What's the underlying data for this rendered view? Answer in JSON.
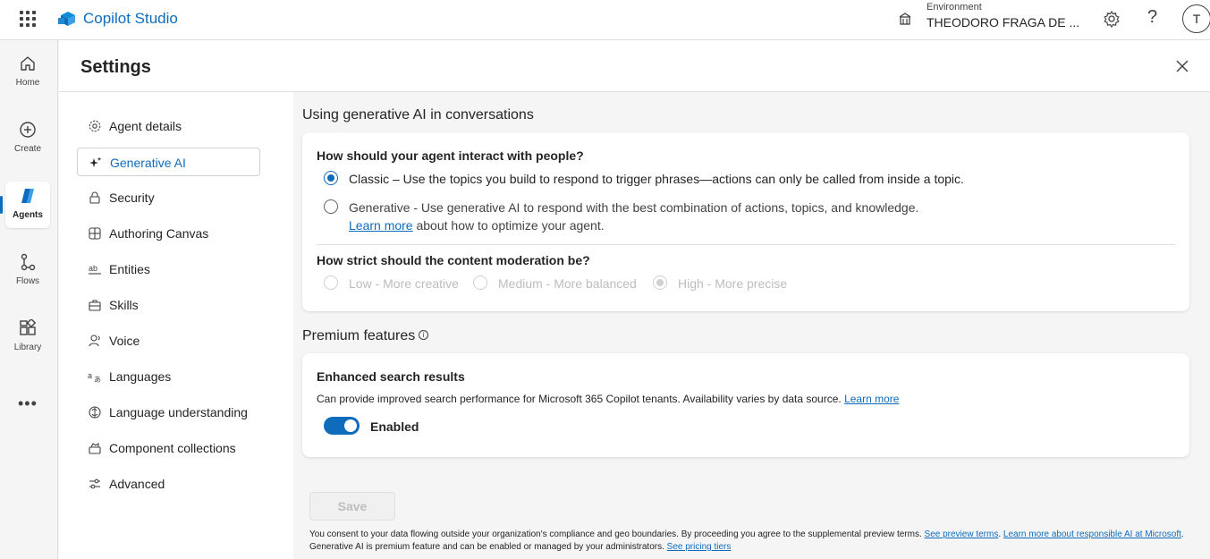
{
  "topbar": {
    "app_title": "Copilot Studio",
    "environment_label": "Environment",
    "environment_value": "THEODORO FRAGA DE ...",
    "avatar_initial": "T"
  },
  "rail": {
    "items": [
      {
        "label": "Home",
        "icon": "home-icon"
      },
      {
        "label": "Create",
        "icon": "plus-circle-icon"
      },
      {
        "label": "Agents",
        "icon": "agents-icon",
        "active": true
      },
      {
        "label": "Flows",
        "icon": "flows-icon"
      },
      {
        "label": "Library",
        "icon": "library-icon"
      }
    ],
    "more_label": "•••"
  },
  "settings": {
    "title": "Settings",
    "nav": [
      {
        "label": "Agent details",
        "icon": "gear-icon"
      },
      {
        "label": "Generative AI",
        "icon": "sparkle-icon",
        "active": true
      },
      {
        "label": "Security",
        "icon": "lock-icon"
      },
      {
        "label": "Authoring Canvas",
        "icon": "grid-icon"
      },
      {
        "label": "Entities",
        "icon": "entities-icon"
      },
      {
        "label": "Skills",
        "icon": "toolbox-icon"
      },
      {
        "label": "Voice",
        "icon": "voice-icon"
      },
      {
        "label": "Languages",
        "icon": "translate-icon"
      },
      {
        "label": "Language understanding",
        "icon": "brain-icon"
      },
      {
        "label": "Component collections",
        "icon": "collection-icon"
      },
      {
        "label": "Advanced",
        "icon": "sliders-icon"
      }
    ]
  },
  "generative": {
    "section_title": "Using generative AI in conversations",
    "interact_question": "How should your agent interact with people?",
    "option_classic": "Classic – Use the topics you build to respond to trigger phrases—actions can only be called from inside a topic.",
    "option_generative": "Generative - Use generative AI to respond with the best combination of actions, topics, and knowledge.",
    "learn_more": "Learn more",
    "learn_more_suffix": " about how to optimize your agent.",
    "moderation_question": "How strict should the content moderation be?",
    "moderation_low": "Low - More creative",
    "moderation_medium": "Medium - More balanced",
    "moderation_high": "High - More precise"
  },
  "premium": {
    "section_title": "Premium features",
    "card_title": "Enhanced search results",
    "card_description": "Can provide improved search performance for Microsoft 365 Copilot tenants. Availability varies by data source.",
    "learn_more": "Learn more",
    "toggle_label": "Enabled",
    "toggle_on": true
  },
  "save_label": "Save",
  "footer": {
    "line1": "You consent to your data flowing outside your organization's compliance and geo boundaries. By proceeding you agree to the supplemental preview terms.",
    "preview_terms": "See preview terms",
    "responsible_ai": "Learn more about responsible AI at Microsoft",
    "line2": "Generative AI is premium feature and can be enabled or managed by your administrators.",
    "pricing": "See pricing tiers"
  },
  "colors": {
    "accent": "#0f6cbd",
    "background": "#f5f5f5",
    "surface": "#ffffff"
  }
}
